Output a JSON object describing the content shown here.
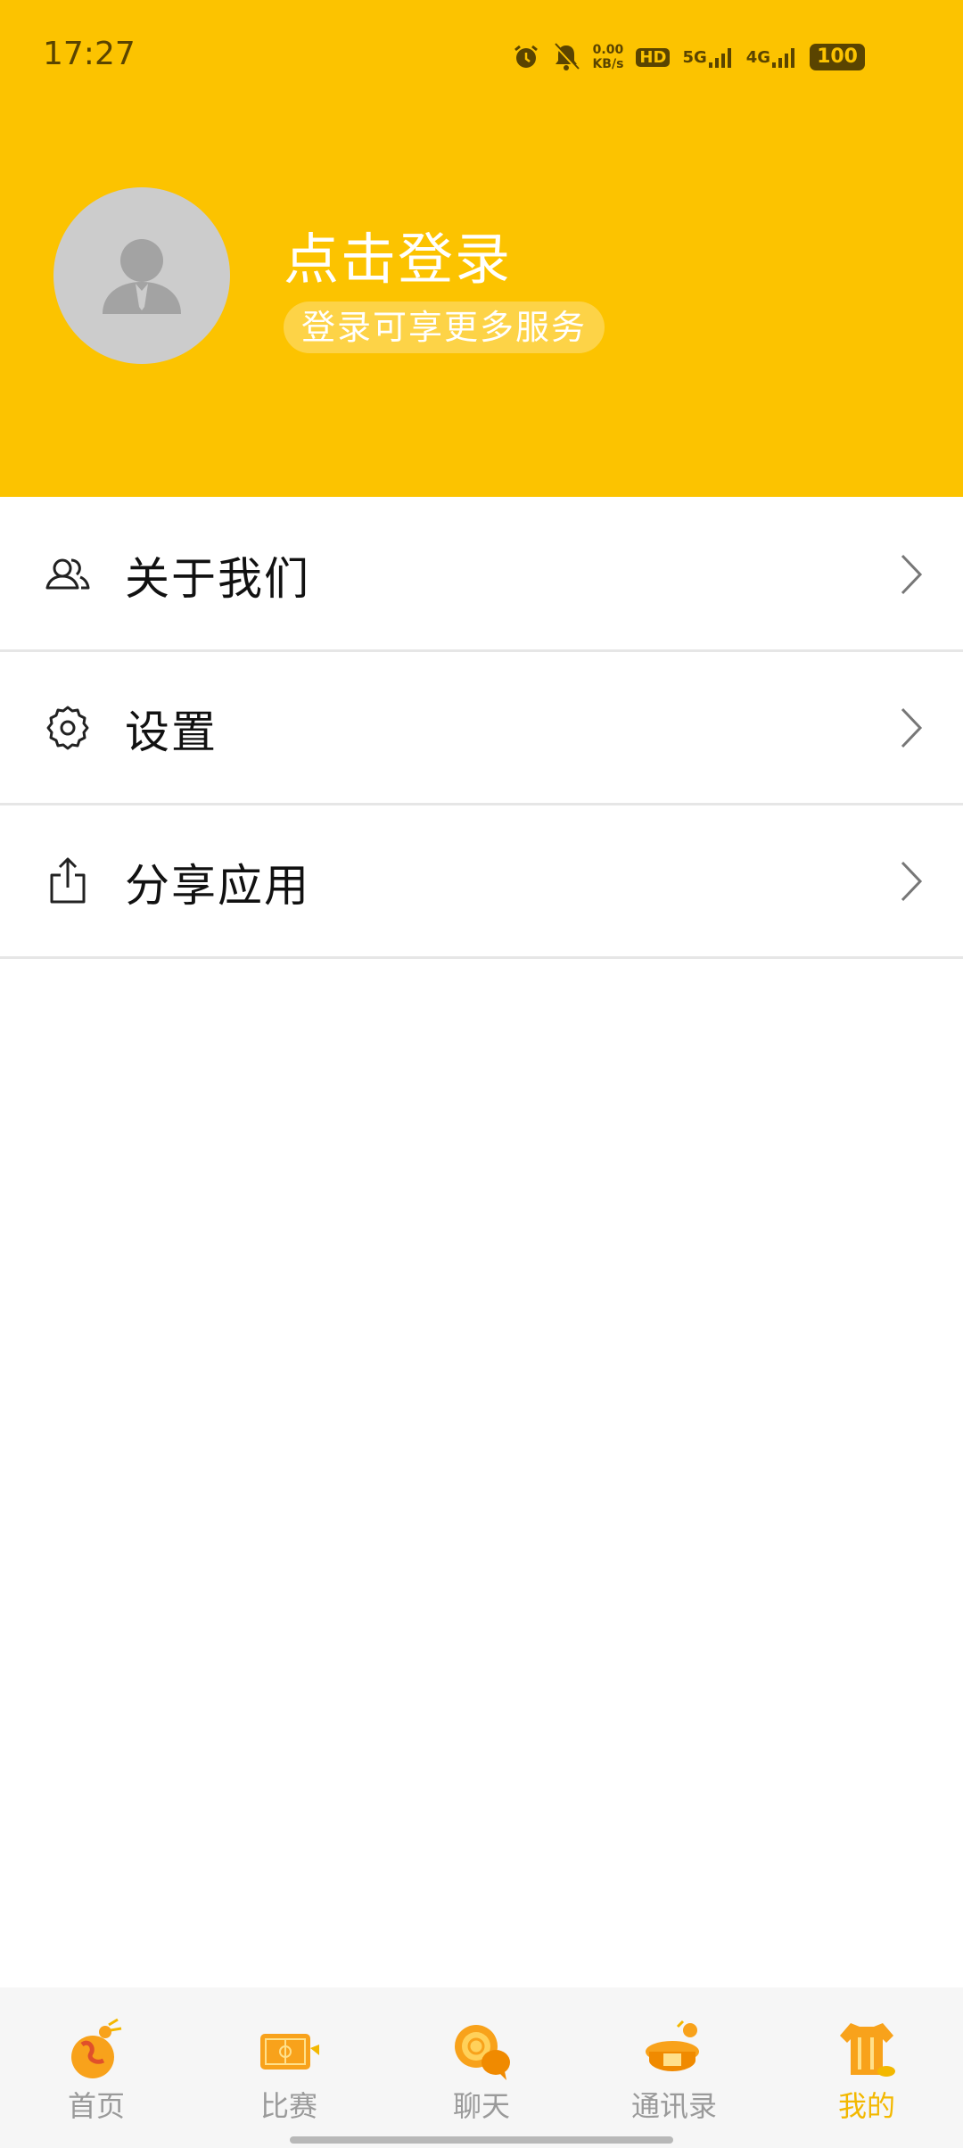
{
  "status_bar": {
    "time": "17:27",
    "net_speed_value": "0.00",
    "net_speed_unit": "KB/s",
    "sim_hd": "HD",
    "sim1_label": "5G",
    "sim2_label": "4G",
    "battery": "100",
    "icons": [
      "alarm-icon",
      "bell-off-icon",
      "hd-icon",
      "signal-icon",
      "signal-icon",
      "battery-icon"
    ]
  },
  "profile": {
    "login_title": "点击登录",
    "login_subtitle": "登录可享更多服务"
  },
  "menu": {
    "items": [
      {
        "label": "关于我们",
        "icon": "users-icon"
      },
      {
        "label": "设置",
        "icon": "gear-icon"
      },
      {
        "label": "分享应用",
        "icon": "share-icon"
      }
    ]
  },
  "bottom_nav": {
    "items": [
      {
        "label": "首页",
        "icon": "home-icon",
        "active": false
      },
      {
        "label": "比赛",
        "icon": "match-icon",
        "active": false
      },
      {
        "label": "聊天",
        "icon": "chat-icon",
        "active": false
      },
      {
        "label": "通讯录",
        "icon": "contacts-icon",
        "active": false
      },
      {
        "label": "我的",
        "icon": "profile-icon",
        "active": true
      }
    ]
  },
  "colors": {
    "header_bg": "#FCC300",
    "active_tab": "#F3B800",
    "inactive_tab": "#9a9a9a"
  }
}
